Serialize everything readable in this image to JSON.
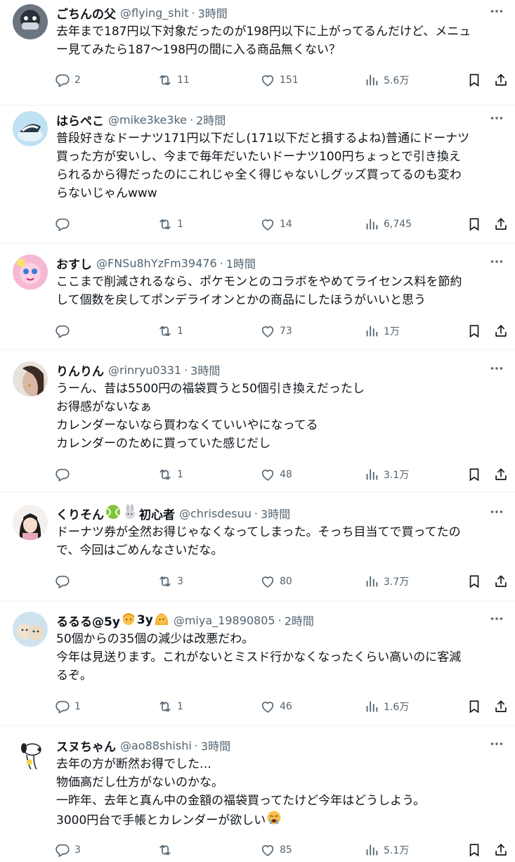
{
  "posts": [
    {
      "name": "ごちんの父",
      "handle": "@flying_shit",
      "time": "3時間",
      "lines": [
        "去年まで187円以下対象だったのが198円以下に上がってるんだけど、メニュ",
        "ー見てみたら187～198円の間に入る商品無くない？"
      ],
      "replies": "2",
      "reposts": "11",
      "likes": "151",
      "views": "5.6万"
    },
    {
      "name": "はらぺこ",
      "handle": "@mike3ke3ke",
      "time": "2時間",
      "lines": [
        "普段好きなドーナツ171円以下だし(171以下だと損するよね)普通にドーナツ",
        "買った方が安いし、今まで毎年だいたいドーナツ100円ちょっとで引き換え",
        "られるから得だったのにこれじゃ全く得じゃないしグッズ買ってるのも変わ",
        "らないじゃんwww"
      ],
      "replies": "",
      "reposts": "1",
      "likes": "14",
      "views": "6,745"
    },
    {
      "name": "おすし",
      "handle": "@FNSu8hYzFm39476",
      "time": "1時間",
      "lines": [
        "ここまで削減されるなら、ポケモンとのコラボをやめてライセンス料を節約",
        "して個数を戻してポンデライオンとかの商品にしたほうがいいと思う"
      ],
      "replies": "",
      "reposts": "1",
      "likes": "73",
      "views": "1万"
    },
    {
      "name": "りんりん",
      "handle": "@rinryu0331",
      "time": "3時間",
      "lines": [
        "うーん、昔は5500円の福袋買うと50個引き換えだったし",
        "お得感がないなぁ",
        "カレンダーないなら買わなくていいやになってる",
        "カレンダーのために買っていた感じだし"
      ],
      "replies": "",
      "reposts": "1",
      "likes": "48",
      "views": "3.1万"
    },
    {
      "name": "くりそん",
      "name_suffix": "初心者",
      "handle": "@chrisdesuu",
      "time": "3時間",
      "lines": [
        "ドーナツ券が全然お得じゃなくなってしまった。そっち目当てで買ってたの",
        "で、今回はごめんなさいだな。"
      ],
      "replies": "",
      "reposts": "3",
      "likes": "80",
      "views": "3.7万"
    },
    {
      "name": "るるる@5y",
      "name_mid": "3y",
      "handle": "@miya_19890805",
      "time": "2時間",
      "lines": [
        "50個からの35個の減少は改悪だわ。",
        "今年は見送ります。これがないとミスド行かなくなったくらい高いのに客減",
        "るぞ。"
      ],
      "replies": "1",
      "reposts": "1",
      "likes": "46",
      "views": "1.6万"
    },
    {
      "name": "スヌちゃん",
      "handle": "@ao88shishi",
      "time": "3時間",
      "lines": [
        "去年の方が断然お得でした…",
        "物価高だし仕方がないのかな。",
        "一昨年、去年と真ん中の金額の福袋買ってたけど今年はどうしよう。",
        "3000円台で手帳とカレンダーが欲しい"
      ],
      "replies": "3",
      "reposts": "",
      "likes": "85",
      "views": "5.1万"
    }
  ],
  "separator": "·",
  "colors": {
    "text": "#0f1419",
    "secondary": "#536471",
    "border": "#eff3f4"
  },
  "icons": [
    "reply-icon",
    "repost-icon",
    "like-icon",
    "views-icon",
    "bookmark-icon",
    "share-icon",
    "more-icon"
  ]
}
